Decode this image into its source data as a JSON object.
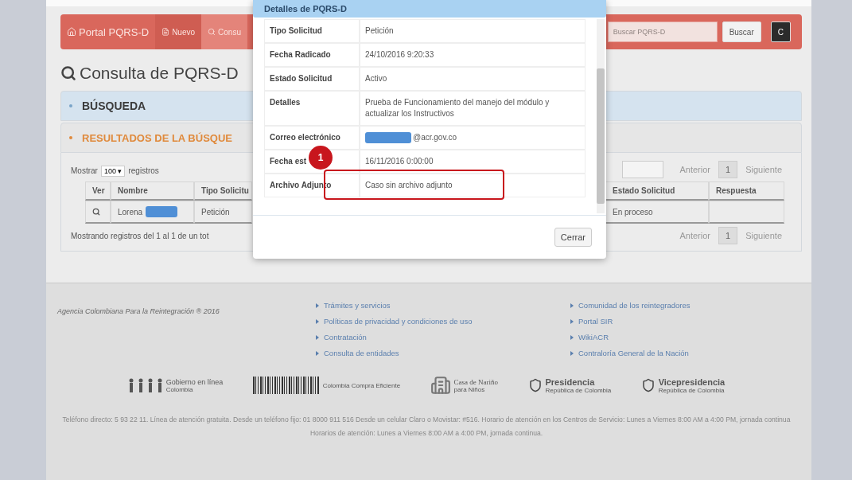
{
  "navbar": {
    "items": [
      {
        "label": "Portal PQRS-D",
        "kind": "brand",
        "selected": false
      },
      {
        "label": "Nuevo",
        "kind": "file",
        "selected": false
      },
      {
        "label": "Consu",
        "kind": "search",
        "selected": true
      }
    ],
    "search": {
      "placeholder": "Buscar PQRS-D"
    },
    "search_button": "Buscar",
    "dark_button": "C"
  },
  "page_title": "Consulta de PQRS-D",
  "search_panel": {
    "title": "BÚSQUEDA",
    "expanded": false
  },
  "results_panel": {
    "title": "RESULTADOS DE LA BÚSQUE",
    "expanded": true,
    "show_prefix": "Mostrar",
    "page_size": "100",
    "show_suffix": "registros",
    "page_size_caret": "▾",
    "pagination_top": {
      "previous": "Anterior",
      "page": "1",
      "next": "Siguiente"
    },
    "pagination_bottom": {
      "previous": "Anterior",
      "page": "1",
      "next": "Siguiente"
    },
    "table": {
      "columns_left": [
        "Ver",
        "Nombre",
        "Tipo Solicitu"
      ],
      "columns_right": [
        "Estado Solicitud",
        "Respuesta"
      ],
      "rows": [
        {
          "name": "Lorena",
          "type": "Petición",
          "status": "En proceso",
          "response": ""
        }
      ]
    },
    "summary": "Mostrando registros del 1 al 1 de un tot"
  },
  "modal": {
    "title": "Detalles de PQRS-D",
    "fields": [
      {
        "label": "Tipo Solicitud",
        "value": "Petición",
        "redacted": false
      },
      {
        "label": "Fecha Radicado",
        "value": "24/10/2016 9:20:33",
        "redacted": false
      },
      {
        "label": "Estado Solicitud",
        "value": "Activo",
        "redacted": false
      },
      {
        "label": "Detalles",
        "value": "Prueba de Funcionamiento del manejo del módulo y actualizar los Instructivos",
        "redacted": false
      },
      {
        "label": "Correo electrónico",
        "value": "@acr.gov.co",
        "redacted": true
      },
      {
        "label": "Fecha est",
        "value": "16/11/2016 0:00:00",
        "redacted": false
      },
      {
        "label": "Archivo Adjunto",
        "value": "Caso sin archivo adjunto",
        "redacted": false
      }
    ],
    "annotation": {
      "number": "1"
    },
    "close_button": "Cerrar"
  },
  "footer": {
    "copyright": "Agencia Colombiana Para la Reintegración ® 2016",
    "links_1": [
      "Trámites y servicios",
      "Políticas de privacidad y condiciones de uso",
      "Contratación",
      "Consulta de entidades"
    ],
    "links_2": [
      "Comunidad de los reintegradores",
      "Portal SIR",
      "WikiACR",
      "Contraloría General de la Nación"
    ],
    "logos": [
      {
        "kind": "people",
        "title": "Gobierno en línea",
        "subtitle": "Colombia"
      },
      {
        "kind": "barcode",
        "subtitle": "Colombia Compra Eficiente"
      },
      {
        "kind": "building",
        "title": "Casa de Nariño",
        "subtitle": "para Niños"
      },
      {
        "kind": "seal",
        "title": "Presidencia",
        "subtitle": "República de Colombia"
      },
      {
        "kind": "seal",
        "title": "Vicepresidencia",
        "subtitle": "República de Colombia"
      }
    ],
    "contact": "Teléfono directo: 5 93 22 11. Línea de atención gratuita. Desde un teléfono fijo: 01 8000 911 516 Desde un celular Claro o Movistar: #516. Horario de atención en los Centros de Servicio: Lunes a Viernes 8:00 AM a 4:00 PM, jornada continua Horarios de atención: Lunes a Viernes 8:00 AM a 4:00 PM, jornada continua."
  }
}
